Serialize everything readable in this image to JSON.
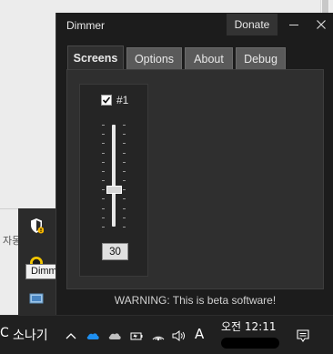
{
  "window": {
    "title": "Dimmer",
    "donate_label": "Donate",
    "minimize_symbol": "—",
    "close_symbol": "✕"
  },
  "tabs": [
    {
      "label": "Screens",
      "active": true
    },
    {
      "label": "Options",
      "active": false
    },
    {
      "label": "About",
      "active": false
    },
    {
      "label": "Debug",
      "active": false
    }
  ],
  "screen": {
    "label": "#1",
    "enabled": true,
    "dim_value": "30"
  },
  "warning": "WARNING: This is beta software!",
  "desktop": {
    "side_text": "자동",
    "tooltip": "Dimm"
  },
  "taskbar": {
    "left_letter": "C",
    "ime_text": "소나기",
    "input_mode": "A",
    "clock": "오전 12:11",
    "icons": [
      "chevron-up-icon",
      "onedrive-icon",
      "cloud-icon",
      "battery-icon",
      "network-icon",
      "wifi-icon",
      "volume-icon",
      "input-mode-icon",
      "notification-icon"
    ]
  },
  "colors": {
    "window_bg": "#1c1c1c",
    "panel_bg": "#2f2f2f",
    "tab_inactive": "#5a5a5a",
    "taskbar": "#202020",
    "onedrive_blue": "#1e8ff0"
  }
}
